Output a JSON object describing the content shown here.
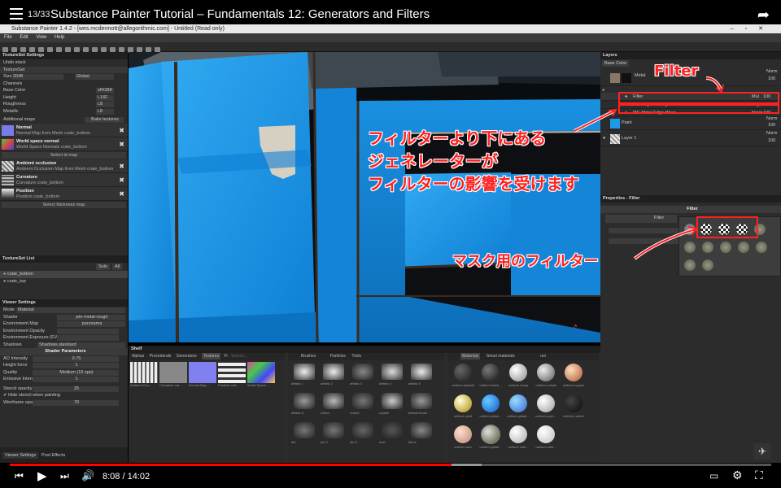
{
  "youtube": {
    "playlist_count": "13/33",
    "title": "Substance Painter Tutorial – Fundamentals 12: Generators and Filters",
    "time": "8:08 / 14:02",
    "progress": 0.58
  },
  "app": {
    "window_title": "Substance Painter 1.4.2 - [wes.mcdermott@allegorithmic.com] - Untitled (Read only)",
    "menu": [
      "File",
      "Edit",
      "View",
      "Help"
    ]
  },
  "textureset_settings": {
    "title": "TextureSet Settings",
    "undo": "Undo stack",
    "textureset": "TextureSet",
    "size_label": "Size",
    "size": "2048",
    "size_lock": "Global",
    "channels_label": "Channels",
    "channels": [
      {
        "name": "Base Color",
        "v": "sRGB8"
      },
      {
        "name": "Height",
        "v": "L16F"
      },
      {
        "name": "Roughness",
        "v": "L8"
      },
      {
        "name": "Metallic",
        "v": "L8"
      }
    ],
    "additional_maps": "Additional maps",
    "bake": "Bake textures",
    "maps": [
      {
        "name": "Normal",
        "desc": "Normal Map from Mesh crate_bottom"
      },
      {
        "name": "World space normal",
        "desc": "World Space Normals crate_bottom"
      },
      {
        "name": "Ambient occlusion",
        "desc": "Ambient Occlusion Map from Mesh crate_bottom"
      },
      {
        "name": "Curvature",
        "desc": "Curvature crate_bottom"
      },
      {
        "name": "Position",
        "desc": "Position crate_bottom"
      }
    ],
    "select_id": "Select id map",
    "select_thickness": "Select thickness map"
  },
  "textureset_list": {
    "title": "TextureSet List",
    "solo": "Solo",
    "all": "All",
    "items": [
      "crate_bottom",
      "crate_top"
    ]
  },
  "viewer_settings": {
    "title": "Viewer Settings",
    "mode_label": "Mode",
    "mode": "Material",
    "shader_label": "Shader",
    "shader": "pbr-metal-rough",
    "envmap_label": "Environment Map",
    "envmap": "panorama",
    "env_opacity": "Environment Opacity",
    "env_exposure": "Environment Exposure (EV)",
    "shadows": "Shadows",
    "shadows_v": "Shadows.standard",
    "shader_params": "Shader Parameters",
    "params": [
      {
        "name": "AO Intensity",
        "v": "0.75"
      },
      {
        "name": "Height force",
        "v": "1"
      },
      {
        "name": "Quality",
        "v": "Medium (16 spp)"
      },
      {
        "name": "Emissive Intensity",
        "v": "1"
      }
    ],
    "stencil_label": "Stencil opacity",
    "stencil": "25",
    "hide_stencil": "Hide stencil when painting",
    "wire_label": "Wireframe opacity",
    "wire": "70",
    "tabs": [
      "Viewer Settings",
      "Post Effects"
    ]
  },
  "layers": {
    "title": "Layers",
    "blend": "Base Color",
    "rows": [
      {
        "name": "Metal",
        "mode": "Norm",
        "op": "100"
      },
      {
        "name": "Filter",
        "mode": "Mul",
        "op": "100"
      },
      {
        "name": "MG Edge Damages",
        "mode": "Lage",
        "op": "100"
      },
      {
        "name": "MG Metal Edge Wear",
        "mode": "Norm",
        "op": "100"
      },
      {
        "name": "Paint",
        "mode": "Norm",
        "op": "100"
      },
      {
        "name": "Layer 1",
        "mode": "Norm",
        "op": "100"
      }
    ]
  },
  "properties": {
    "title": "Properties - Filter",
    "section": "Filter",
    "filter_label": "Filter"
  },
  "shelf": {
    "title": "Shelf",
    "tabs_left": [
      "Alphas",
      "Procedurals",
      "Generators",
      "Textures",
      "Fi"
    ],
    "search": "Search...",
    "textures": [
      "Ambient Occ...",
      "Curvature ma...",
      "Normal Map ...",
      "Position crat...",
      "World Space ..."
    ],
    "tabs_mid": [
      "Brushes",
      "Particles",
      "Tools"
    ],
    "brushes": [
      "artistic 1",
      "artistic 2",
      "artistic 3",
      "artistic 4",
      "artistic 5",
      "artistic 6",
      "cotton",
      "cracks",
      "crystal",
      "default brush",
      "dirt",
      "dirt 2",
      "dirt 3",
      "dust",
      "fibers"
    ],
    "tabs_right": [
      "Materials",
      "Smart materials"
    ],
    "mat_search": "uni",
    "materials": [
      "uniform asphalt",
      "uniform black...",
      "uniform bump",
      "uniform cobalt",
      "uniform copper",
      "uniform gold",
      "uniform plasti...",
      "uniform plasti...",
      "uniform pure...",
      "uniform rubber",
      "uniform skin",
      "uniform plasti...",
      "uniform whit...",
      "uniform whit..."
    ]
  },
  "annotations": {
    "filter_label": "Filter",
    "main_line1": "フィルターより下にある",
    "main_line2": "ジェネレーターが",
    "main_line3": "フィルターの影響を受けます",
    "mask_label": "マスク用のフィルター"
  },
  "colors": {
    "accent": "#ff2020",
    "progress": "#ff0000",
    "blue": "#1e9be8"
  }
}
